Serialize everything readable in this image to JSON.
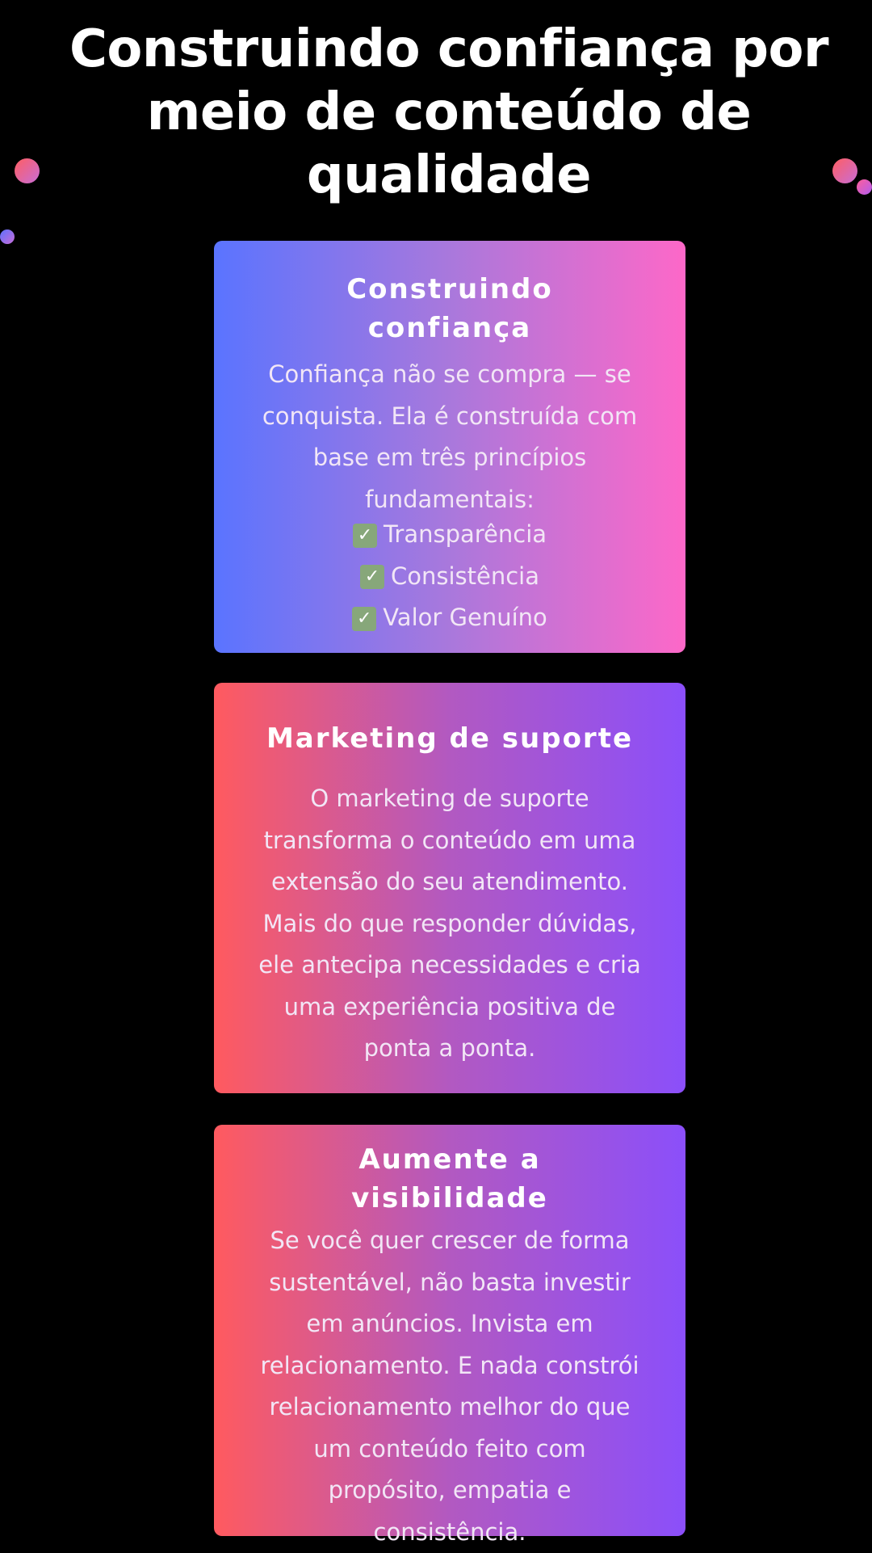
{
  "page": {
    "title": "Construindo confiança por meio de conteúdo de qualidade"
  },
  "cards": [
    {
      "title": "Construindo confiança",
      "body": "Confiança não se compra — se conquista. Ela é construída com base em três princípios fundamentais:",
      "checklist": [
        "Transparência",
        "Consistência",
        "Valor Genuíno"
      ],
      "check_icon": "✓",
      "gradient": [
        "#5a74ff",
        "#a978dc",
        "#fd68c8"
      ]
    },
    {
      "title": "Marketing de suporte",
      "body": "O marketing de suporte transforma o conteúdo em uma extensão do seu atendimento. Mais do que responder dúvidas, ele antecipa necessidades e cria uma experiência positiva de ponta a ponta.",
      "gradient": [
        "#ff5a5f",
        "#b259c1",
        "#8b4ffa"
      ]
    },
    {
      "title": "Aumente a visibilidade",
      "body": "Se você quer crescer de forma sustentável, não basta investir em anúncios. Invista em relacionamento. E nada constrói relacionamento melhor do que um conteúdo feito com propósito, empatia e consistência.",
      "gradient": [
        "#ff5a5f",
        "#b259c1",
        "#8b4ffa"
      ]
    }
  ],
  "colors": {
    "background": "#000000",
    "title_text": "#ffffff",
    "body_text": "#f2e6f6",
    "check_icon_bg": "#87a77a"
  }
}
